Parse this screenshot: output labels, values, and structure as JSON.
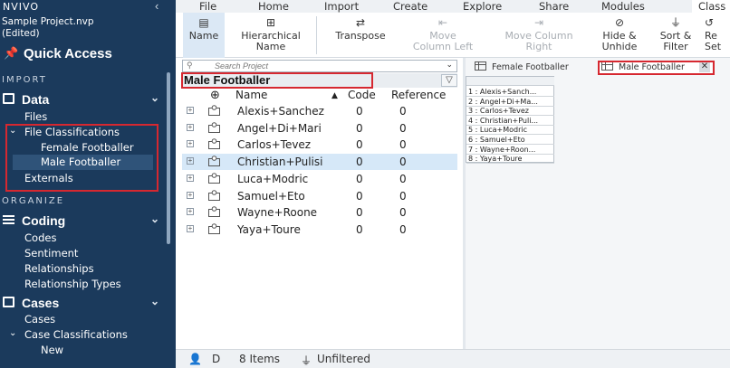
{
  "sidebar": {
    "logo": "NVIVO",
    "collapse_glyph": "‹",
    "project_name": "Sample Project.nvp",
    "project_state": "(Edited)",
    "quick_access": "Quick Access",
    "sections": {
      "import": "IMPORT",
      "organize": "ORGANIZE"
    },
    "data": {
      "label": "Data",
      "files": "Files",
      "file_classifications": "File Classifications",
      "female": "Female Footballer",
      "male": "Male Footballer",
      "externals": "Externals"
    },
    "coding": {
      "label": "Coding",
      "codes": "Codes",
      "sentiment": "Sentiment",
      "relationships": "Relationships",
      "relationship_types": "Relationship Types"
    },
    "cases": {
      "label": "Cases",
      "cases": "Cases",
      "case_classifications": "Case Classifications",
      "new": "New"
    }
  },
  "ribbon": {
    "tabs": [
      "File",
      "Home",
      "Import",
      "Create",
      "Explore",
      "Share",
      "Modules",
      "Class"
    ],
    "buttons": {
      "name": {
        "l1": "Name",
        "l2": ""
      },
      "hierarchical": {
        "l1": "Hierarchical",
        "l2": "Name"
      },
      "transpose": {
        "l1": "Transpose",
        "l2": ""
      },
      "move_left": {
        "l1": "Move",
        "l2": "Column Left"
      },
      "move_right": {
        "l1": "Move Column",
        "l2": "Right"
      },
      "hide": {
        "l1": "Hide &",
        "l2": "Unhide"
      },
      "sort": {
        "l1": "Sort &",
        "l2": "Filter"
      },
      "reset": {
        "l1": "Re",
        "l2": "Set"
      }
    }
  },
  "navigator": {
    "search_placeholder": "Search Project",
    "title": "Male Footballer",
    "columns": {
      "name": "Name",
      "code": "Code",
      "reference": "Reference"
    },
    "rows": [
      {
        "name": "Alexis+Sanchez",
        "code": "0",
        "reference": "0"
      },
      {
        "name": "Angel+Di+Mari",
        "code": "0",
        "reference": "0"
      },
      {
        "name": "Carlos+Tevez",
        "code": "0",
        "reference": "0"
      },
      {
        "name": "Christian+Pulisi",
        "code": "0",
        "reference": "0"
      },
      {
        "name": "Luca+Modric",
        "code": "0",
        "reference": "0"
      },
      {
        "name": "Samuel+Eto",
        "code": "0",
        "reference": "0"
      },
      {
        "name": "Wayne+Roone",
        "code": "0",
        "reference": "0"
      },
      {
        "name": "Yaya+Toure",
        "code": "0",
        "reference": "0"
      }
    ]
  },
  "detail": {
    "tabs": [
      "Female Footballer",
      "Male Footballer"
    ],
    "grid_rows": [
      "1 : Alexis+Sanch...",
      "2 : Angel+Di+Ma...",
      "3 : Carlos+Tevez",
      "4 : Christian+Puli...",
      "5 : Luca+Modric",
      "6 : Samuel+Eto",
      "7 : Wayne+Roon...",
      "8 : Yaya+Toure"
    ]
  },
  "status": {
    "user": "D",
    "items": "8 Items",
    "filter": "Unfiltered"
  },
  "colors": {
    "sidebar_bg": "#1b3a5c",
    "selected_row": "#d6e8f8",
    "highlight_box": "#d62830"
  }
}
